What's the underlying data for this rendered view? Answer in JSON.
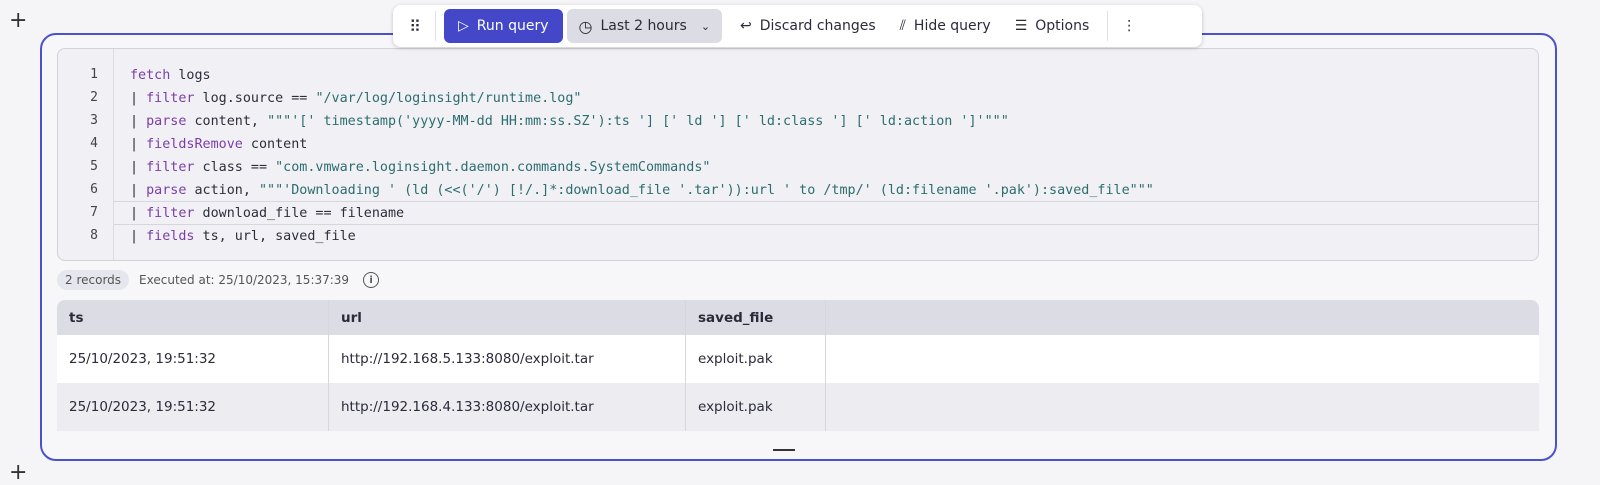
{
  "toolbar": {
    "drag_icon": "drag-handle-icon",
    "run_label": "Run query",
    "time_label": "Last 2 hours",
    "discard_label": "Discard changes",
    "hide_label": "Hide query",
    "options_label": "Options"
  },
  "editor": {
    "lines": [
      [
        {
          "t": "fetch",
          "c": "kw"
        },
        {
          "t": " logs"
        }
      ],
      [
        {
          "t": "| "
        },
        {
          "t": "filter",
          "c": "kw"
        },
        {
          "t": " log.source == "
        },
        {
          "t": "\"/var/log/loginsight/runtime.log\"",
          "c": "st"
        }
      ],
      [
        {
          "t": "| "
        },
        {
          "t": "parse",
          "c": "kw"
        },
        {
          "t": " content, "
        },
        {
          "t": "\"\"\"'[' timestamp('yyyy-MM-dd HH:mm:ss.SZ'):ts '] [' ld '] [' ld:class '] [' ld:action ']'\"\"\"",
          "c": "st"
        }
      ],
      [
        {
          "t": "| "
        },
        {
          "t": "fieldsRemove",
          "c": "kw"
        },
        {
          "t": " content"
        }
      ],
      [
        {
          "t": "| "
        },
        {
          "t": "filter",
          "c": "kw"
        },
        {
          "t": " class == "
        },
        {
          "t": "\"com.vmware.loginsight.daemon.commands.SystemCommands\"",
          "c": "st"
        }
      ],
      [
        {
          "t": "| "
        },
        {
          "t": "parse",
          "c": "kw"
        },
        {
          "t": " action, "
        },
        {
          "t": "\"\"\"'Downloading ' (ld (<<('/') [!/.]*:download_file '.tar')):url ' to /tmp/' (ld:filename '.pak'):saved_file\"\"\"",
          "c": "st"
        }
      ],
      [
        {
          "t": "| "
        },
        {
          "t": "filter",
          "c": "kw"
        },
        {
          "t": " download_file == filename"
        }
      ],
      [
        {
          "t": "| "
        },
        {
          "t": "fields",
          "c": "kw"
        },
        {
          "t": " ts, url, saved_file"
        }
      ]
    ]
  },
  "results": {
    "records": "2 records",
    "executed": "Executed at: 25/10/2023, 15:37:39",
    "columns": [
      "ts",
      "url",
      "saved_file",
      ""
    ],
    "rows": [
      [
        "25/10/2023, 19:51:32",
        "http://192.168.5.133:8080/exploit.tar",
        "exploit.pak",
        ""
      ],
      [
        "25/10/2023, 19:51:32",
        "http://192.168.4.133:8080/exploit.tar",
        "exploit.pak",
        ""
      ]
    ]
  },
  "colors": {
    "accent": "#4448c8",
    "border": "#4b52c9",
    "keyword": "#7a3ea6",
    "string": "#2c6d6f"
  }
}
